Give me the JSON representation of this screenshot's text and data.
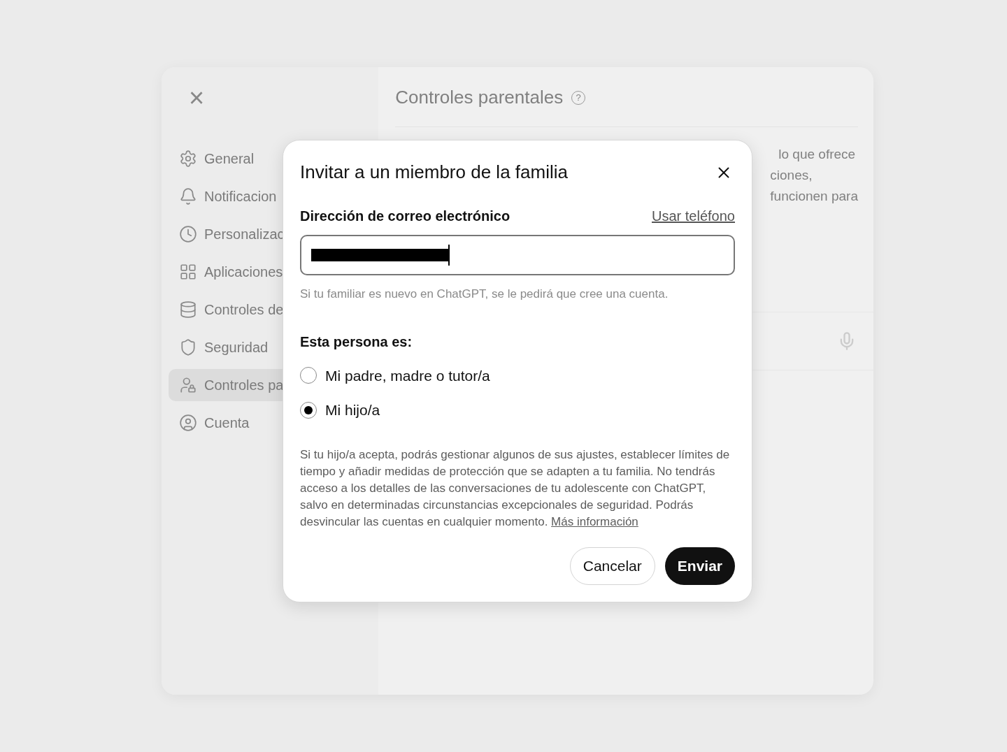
{
  "settings": {
    "close_label": "×",
    "title": "Controles parentales",
    "help": "?",
    "sidebar": [
      {
        "label": "General",
        "selected": false
      },
      {
        "label": "Notificacion",
        "selected": false
      },
      {
        "label": "Personalizac",
        "selected": false
      },
      {
        "label": "Aplicaciones",
        "selected": false
      },
      {
        "label": "Controles de",
        "selected": false
      },
      {
        "label": "Seguridad",
        "selected": false
      },
      {
        "label": "Controles pa",
        "selected": true
      },
      {
        "label": "Cuenta",
        "selected": false
      }
    ],
    "content_lines": [
      "lo que ofrece",
      "ciones,",
      "funcionen para"
    ]
  },
  "dialog": {
    "title": "Invitar a un miembro de la familia",
    "email_label": "Dirección de correo electrónico",
    "phone_link": "Usar teléfono",
    "hint": "Si tu familiar es nuevo en ChatGPT, se le pedirá que cree una cuenta.",
    "question": "Esta persona es:",
    "options": [
      {
        "label": "Mi padre, madre o tutor/a",
        "selected": false
      },
      {
        "label": "Mi hijo/a",
        "selected": true
      }
    ],
    "info": "Si tu hijo/a acepta, podrás gestionar algunos de sus ajustes, establecer límites de tiempo y añadir medidas de protección que se adapten a tu familia. No tendrás acceso a los detalles de las conversaciones de tu adolescente con ChatGPT, salvo en determinadas circunstancias excepcionales de seguridad. Podrás desvincular las cuentas en cualquier momento.",
    "info_link": "Más información",
    "buttons": [
      {
        "label": "Cancelar",
        "kind": "secondary"
      },
      {
        "label": "Enviar",
        "kind": "primary"
      }
    ]
  }
}
